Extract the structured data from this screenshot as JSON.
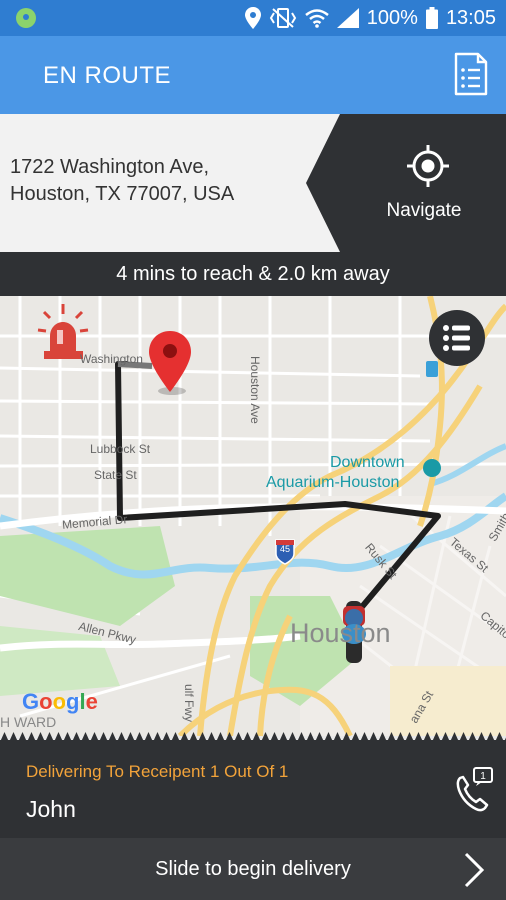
{
  "status_bar": {
    "battery": "100%",
    "time": "13:05"
  },
  "app_bar": {
    "title": "EN ROUTE"
  },
  "destination": {
    "address_line1": "1722 Washington Ave,",
    "address_line2": "Houston, TX 77007, USA",
    "navigate_label": "Navigate"
  },
  "eta": {
    "text": "4 mins to reach & 2.0 km away"
  },
  "map": {
    "labels": {
      "washington": "Washington",
      "houston_ave": "Houston Ave",
      "lubbock": "Lubbock St",
      "state": "State St",
      "downtown": "Downtown",
      "aquarium": "Aquarium-Houston",
      "memorial": "Memorial Dr",
      "i45": "45",
      "rusk": "Rusk St",
      "texas": "Texas St",
      "smith": "Smith",
      "capitol": "Capito",
      "allen": "Allen Pkwy",
      "houston": "Houston",
      "fwy": "ulf Fwy",
      "lamar": "ana St",
      "fourth_ward": "H WARD",
      "google": "Google"
    },
    "colors": {
      "route": "#1f1f1f",
      "pin": "#e53030",
      "park": "#bfe3b0",
      "water": "#9fd6f0",
      "highway": "#f6d27a"
    }
  },
  "recipient": {
    "status": "Delivering To Receipent 1 Out Of 1",
    "name": "John",
    "call_badge": "1"
  },
  "slide": {
    "label": "Slide to begin delivery"
  },
  "icons": {
    "status_left": "location-badge-icon",
    "location": "location-icon",
    "mute": "vibrate-icon",
    "wifi": "wifi-icon",
    "signal": "signal-icon",
    "battery": "battery-icon",
    "doc": "document-list-icon",
    "navigate": "crosshair-icon",
    "list": "list-icon",
    "alarm": "siren-icon",
    "pin": "map-pin-icon",
    "courier": "courier-icon",
    "call": "phone-icon",
    "chevron": "chevron-right-icon"
  }
}
